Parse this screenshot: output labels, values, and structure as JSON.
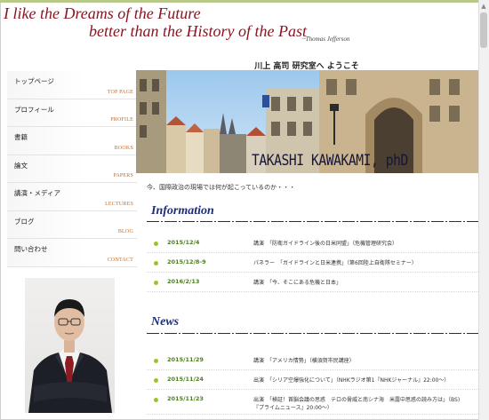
{
  "header": {
    "motto_line1": "I like the Dreams of the Future",
    "motto_line2": "better than the History of the Past",
    "motto_author": "~Thomas Jefferson"
  },
  "page_heading": "川上 高司 研究室へ ようこそ",
  "sidebar": {
    "items": [
      {
        "jp": "トップページ",
        "en": "TOP PAGE"
      },
      {
        "jp": "プロフィール",
        "en": "PROFILE"
      },
      {
        "jp": "書籍",
        "en": "BOOKS"
      },
      {
        "jp": "論文",
        "en": "PAPERS"
      },
      {
        "jp": "講演・メディア",
        "en": "LECTURES"
      },
      {
        "jp": "ブログ",
        "en": "BLOG"
      },
      {
        "jp": "問い合わせ",
        "en": "CONTACT"
      }
    ]
  },
  "hero": {
    "name": "TAKASHI KAWAKAMI, phD"
  },
  "intro": "今、国際政治の現場では何が起こっているのか・・・",
  "information": {
    "title": "Information",
    "items": [
      {
        "date": "2015/12/4",
        "desc": "講演　「防衛ガイドライン後の日米同盟」（危機管理研究会）"
      },
      {
        "date": "2015/12/8-9",
        "desc": "パネラー　「ガイドラインと日米連携」（第6回陸上自衛隊セミナー）"
      },
      {
        "date": "2016/2/13",
        "desc": "講演　「今、そこにある危機と日本」"
      }
    ]
  },
  "news": {
    "title": "News",
    "items": [
      {
        "date": "2015/11/29",
        "desc": "講演　「アメリカ情勢」（横須賀市民講座）",
        "desc2": ""
      },
      {
        "date": "2015/11/24",
        "desc": "出演　「シリア空爆強化について」（NHKラジオ第1『NHKジャーナル』22:00～）",
        "desc2": ""
      },
      {
        "date": "2015/11/23",
        "desc": "出演　「検証！首脳会議の思惑　テロの脅威と南シナ海　米露中思惑の読み方は」（BS)",
        "desc2": "『プライムニュース』20:00～）"
      }
    ]
  },
  "colors": {
    "motto": "#8a1522",
    "section_title": "#1c2e7a",
    "date": "#4b7f1c",
    "bullet": "#9cc22a",
    "nav_en": "#c36b2a"
  }
}
